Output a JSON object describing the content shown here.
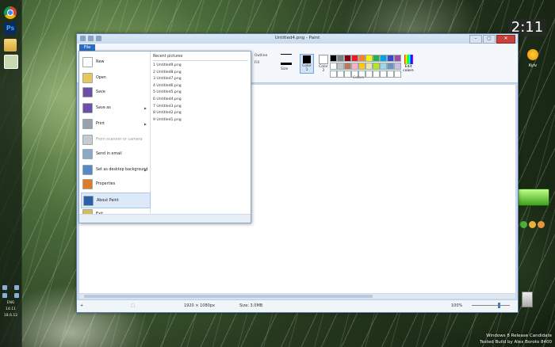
{
  "desktop": {
    "clock": "2:11",
    "weather_text": "Kyiv",
    "tray_lang": "ENG",
    "tray_time": "14:11",
    "tray_date": "18.6.12",
    "watermark_line1": "Windows 8 Release Candidate",
    "watermark_line2": "Tested Build by Alex Boroto 8400"
  },
  "window": {
    "title": "Untitled4.png - Paint",
    "minimize": "–",
    "maximize": "▢",
    "close": "✕"
  },
  "ribbon": {
    "file_tab": "File",
    "outline_label": "Outline",
    "fill_label": "Fill",
    "size_label": "Size",
    "color1_label": "Color 1",
    "color2_label": "Color 2",
    "edit_colors_label": "Edit colors",
    "colors_group_label": "Colors",
    "palette": [
      "#000000",
      "#7f7f7f",
      "#880015",
      "#ed1c24",
      "#ff7f27",
      "#fff200",
      "#22b14c",
      "#00a2e8",
      "#3f48cc",
      "#a349a4",
      "#ffffff",
      "#c3c3c3",
      "#b97a57",
      "#ffaec9",
      "#ffc90e",
      "#efe4b0",
      "#b5e61d",
      "#99d9ea",
      "#7092be",
      "#c8bfe7",
      "#ffffff",
      "#ffffff",
      "#ffffff",
      "#ffffff",
      "#ffffff",
      "#ffffff",
      "#ffffff",
      "#ffffff",
      "#ffffff",
      "#ffffff"
    ]
  },
  "file_menu": {
    "items": [
      {
        "label": "New",
        "icon": "new-document-icon",
        "color": "#ffffff",
        "arrow": ""
      },
      {
        "label": "Open",
        "icon": "open-folder-icon",
        "color": "#e8c65a",
        "arrow": ""
      },
      {
        "label": "Save",
        "icon": "save-disk-icon",
        "color": "#6b4fa8",
        "arrow": ""
      },
      {
        "label": "Save as",
        "icon": "save-as-icon",
        "color": "#6b4fa8",
        "arrow": "▶"
      },
      {
        "label": "Print",
        "icon": "printer-icon",
        "color": "#9aa2ad",
        "arrow": "▶"
      },
      {
        "label": "From scanner or camera",
        "icon": "scanner-icon",
        "color": "#c7cbd1",
        "arrow": ""
      },
      {
        "label": "Send in email",
        "icon": "email-icon",
        "color": "#8fa7c6",
        "arrow": ""
      },
      {
        "label": "Set as desktop background",
        "icon": "desktop-background-icon",
        "color": "#5a88c6",
        "arrow": "▶"
      },
      {
        "label": "Properties",
        "icon": "properties-check-icon",
        "color": "#e07a28",
        "arrow": ""
      },
      {
        "label": "About Paint",
        "icon": "info-icon",
        "color": "#2f5fa8",
        "arrow": ""
      },
      {
        "label": "Exit",
        "icon": "exit-icon",
        "color": "#d9b95a",
        "arrow": ""
      }
    ],
    "recent_header": "Recent pictures",
    "recent": [
      "1  Untitled9.png",
      "2  Untitled8.png",
      "3  Untitled7.png",
      "4  Untitled6.png",
      "5  Untitled5.png",
      "6  Untitled4.png",
      "7  Untitled3.png",
      "8  Untitled2.png",
      "9  Untitled1.png"
    ]
  },
  "status": {
    "dimensions": "1920 × 1080px",
    "size": "Size: 3.0MB",
    "zoom": "100%"
  }
}
